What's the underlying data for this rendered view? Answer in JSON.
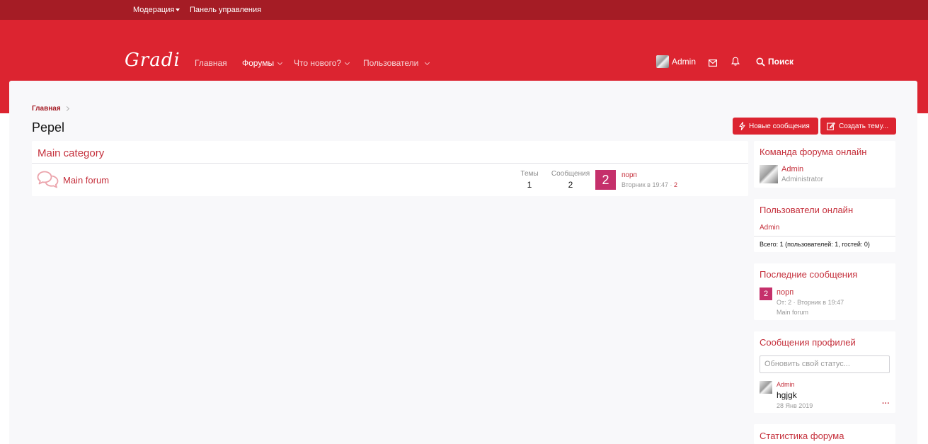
{
  "staffbar": {
    "moderation_label": "Модерация",
    "control_panel_label": "Панель управления"
  },
  "header": {
    "logo": "Gradi",
    "nav": {
      "home": "Главная",
      "forums": "Форумы",
      "whats_new": "Что нового?",
      "members": "Пользователи"
    },
    "user": "Admin",
    "search": "Поиск"
  },
  "breadcrumb": {
    "home": "Главная"
  },
  "page": {
    "title": "Pepel",
    "new_posts_button": "Новые сообщения",
    "create_thread_button": "Создать тему..."
  },
  "forum_list": {
    "category": "Main category",
    "forums": [
      {
        "title": "Main forum",
        "threads_label": "Темы",
        "threads": "1",
        "messages_label": "Сообщения",
        "messages": "2",
        "last_avatar_letter": "2",
        "last_thread": "порп",
        "last_date": "Вторник в 19:47",
        "last_sep": "·",
        "last_user": "2"
      }
    ]
  },
  "sidebar": {
    "staff_online": {
      "title": "Команда форума онлайн",
      "user": "Admin",
      "role": "Administrator"
    },
    "members_online": {
      "title": "Пользователи онлайн",
      "user": "Admin",
      "total": "Всего: 1 (пользователей: 1, гостей: 0)"
    },
    "latest_posts": {
      "title": "Последние сообщения",
      "avatar_letter": "2",
      "thread": "порп",
      "meta": "От: 2 · Вторник в 19:47",
      "forum": "Main forum"
    },
    "profile_posts": {
      "title": "Сообщения профилей",
      "status_placeholder": "Обновить свой статус...",
      "user": "Admin",
      "text": "hgjgk",
      "date": "28 Янв 2019",
      "more": "···"
    },
    "forum_stats": {
      "title": "Статистика форума"
    }
  },
  "colors": {
    "staffbar": "#a51c25",
    "header": "#dc2430",
    "accent": "#c5303c",
    "avatar_bg": "#c5306b"
  }
}
